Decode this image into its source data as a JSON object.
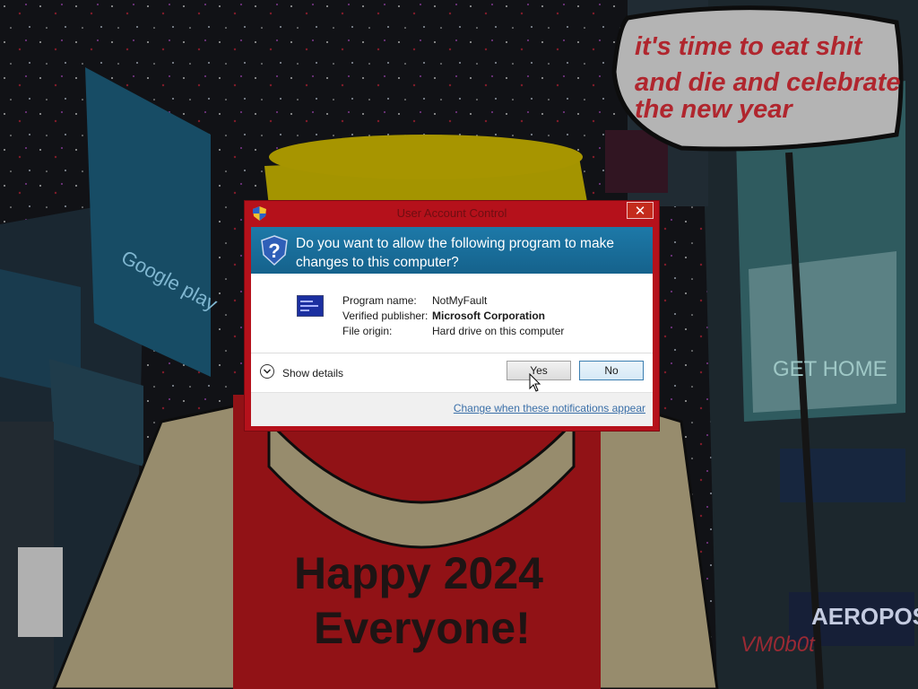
{
  "wallpaper": {
    "speech_bubble": [
      "it's time to eat shit",
      "and die and celebrate",
      "the new year"
    ],
    "shirt_text": [
      "Happy 2024",
      "Everyone!"
    ],
    "watermark": "VM0b0t",
    "billboard_google": "Google play",
    "billboard_get_home": "GET HOME",
    "billboard_aero": "AEROPOS"
  },
  "dialog": {
    "title": "User Account Control",
    "close_glyph": "✕",
    "question": "Do you want to allow the following program to make changes to this computer?",
    "fields": [
      {
        "label": "Program name:",
        "value": "NotMyFault"
      },
      {
        "label": "Verified publisher:",
        "value": "Microsoft Corporation"
      },
      {
        "label": "File origin:",
        "value": "Hard drive on this computer"
      }
    ],
    "show_details": "Show details",
    "yes": "Yes",
    "no": "No",
    "change_link": "Change when these notifications appear"
  },
  "colors": {
    "uac_border": "#b5111b",
    "uac_header": "#1a6c9a"
  }
}
